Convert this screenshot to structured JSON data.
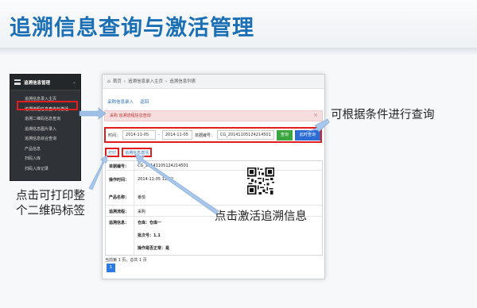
{
  "slide": {
    "title": "追溯信息查询与激活管理"
  },
  "side_menu": {
    "header": "追溯信息管理",
    "items": [
      {
        "label": "追溯信息录入主页"
      },
      {
        "label": "追溯流程信息查询与激活"
      },
      {
        "label": "追溯二维码信息查询"
      },
      {
        "label": "追溯信息图片录入"
      },
      {
        "label": "追溯信息综合查询"
      },
      {
        "label": "产品信息"
      },
      {
        "label": "扫码入库"
      },
      {
        "label": "扫码入库记录"
      }
    ]
  },
  "panel": {
    "breadcrumb": [
      "首页",
      "追溯信息录入主页",
      "追溯信息列表"
    ],
    "tabs": [
      "采购信息录入",
      "返回"
    ],
    "alert": "采购 追溯流程信息查询",
    "alert_close": "×",
    "search": {
      "time_label": "时间：",
      "date_from": "2014-11-05",
      "separator": "-",
      "date_to": "2014-11-05",
      "order_label": "单据编号：",
      "order_no": "CG_20141105124214501",
      "query_btn": "查询",
      "all_btn": "此时查询"
    },
    "actions": {
      "print": "打印",
      "activate": "追溯信息激活"
    },
    "detail": {
      "order_label": "单据编号：",
      "order_value": "CG_20141105124214501",
      "op_time_label": "操作时间：",
      "op_time_value": "2014-11-05 12:42",
      "product_label": "产品名称：",
      "product_value": "番茄",
      "flow_label": "追溯流程：",
      "flow_value": "采购",
      "info_label": "追溯信息：",
      "warehouse": "仓库：仓库一",
      "batch": "批次号：1.1",
      "process": "操作是否正常：是"
    },
    "pager_text": "当前第 1 页，总共 1 页",
    "page_number": "1"
  },
  "callouts": {
    "query": "可根据条件进行查询",
    "print_line1": "点击可打印整",
    "print_line2": "个二维码标签",
    "activate": "点击激活追溯信息"
  }
}
